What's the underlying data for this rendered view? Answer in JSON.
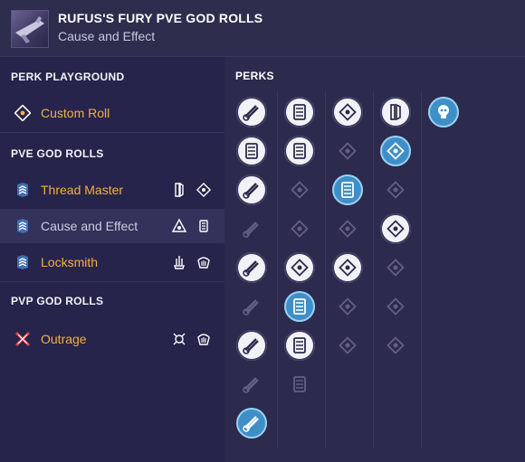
{
  "header": {
    "title": "RUFUS'S FURY PVE GOD ROLLS",
    "subtitle": "Cause and Effect",
    "thumbnail_icon": "weapon-thumbnail"
  },
  "sidebar": {
    "perk_playground": {
      "heading": "PERK PLAYGROUND",
      "item": {
        "label": "Custom Roll",
        "icon": "custom-roll-icon"
      }
    },
    "pve": {
      "heading": "PVE GOD ROLLS",
      "items": [
        {
          "label": "Thread Master",
          "icons": [
            "rifled-barrel-icon",
            "perk-icon"
          ]
        },
        {
          "label": "Cause and Effect",
          "icons": [
            "perk-icon",
            "magazine-icon"
          ]
        },
        {
          "label": "Locksmith",
          "icons": [
            "perk-icon",
            "perk-icon"
          ]
        }
      ]
    },
    "pvp": {
      "heading": "PVP GOD ROLLS",
      "items": [
        {
          "label": "Outrage",
          "icons": [
            "perk-icon",
            "perk-icon"
          ]
        }
      ]
    }
  },
  "perks": {
    "heading": "PERKS",
    "colors": {
      "accent": "#f4b040",
      "selected": "#3e8fc8",
      "background": "#2b2946"
    }
  }
}
